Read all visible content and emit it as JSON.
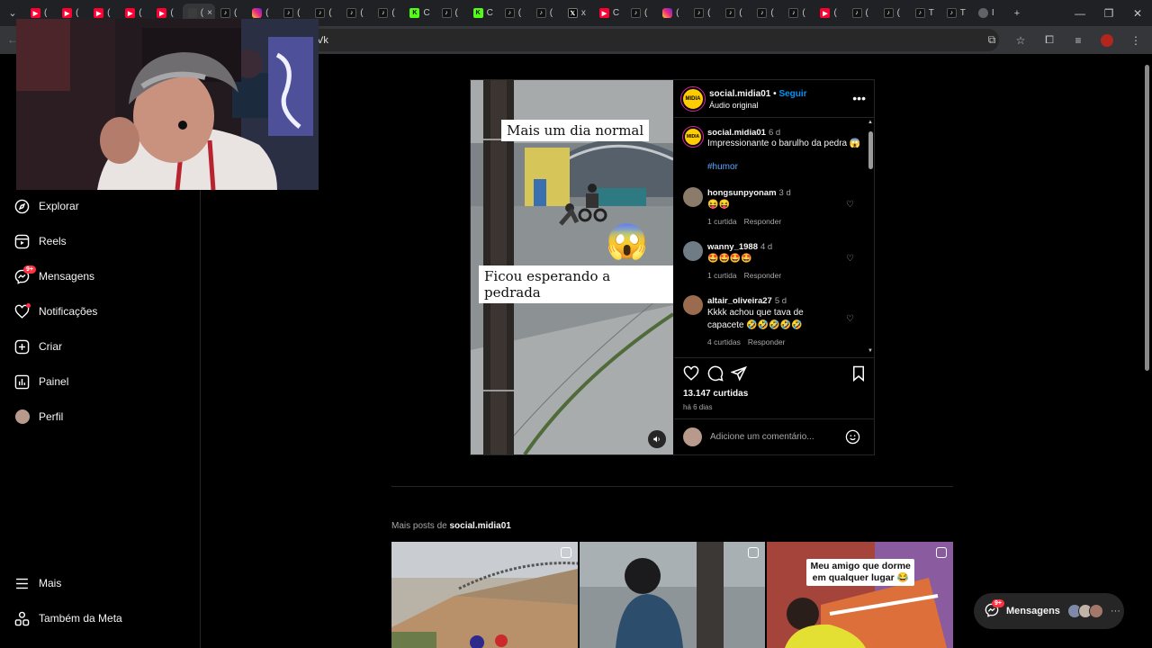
{
  "browser": {
    "tabs": [
      {
        "icon": "youtube",
        "label": "("
      },
      {
        "icon": "youtube",
        "label": "("
      },
      {
        "icon": "youtube",
        "label": "("
      },
      {
        "icon": "youtube",
        "label": "("
      },
      {
        "icon": "youtube",
        "label": "("
      },
      {
        "icon": "blank",
        "label": "(",
        "active": true,
        "close": "×"
      },
      {
        "icon": "tiktok",
        "label": "("
      },
      {
        "icon": "instagram",
        "label": "("
      },
      {
        "icon": "tiktok",
        "label": "("
      },
      {
        "icon": "tiktok",
        "label": "("
      },
      {
        "icon": "tiktok",
        "label": "("
      },
      {
        "icon": "tiktok",
        "label": "("
      },
      {
        "icon": "kick",
        "label": "C"
      },
      {
        "icon": "tiktok",
        "label": "("
      },
      {
        "icon": "kick",
        "label": "C"
      },
      {
        "icon": "tiktok",
        "label": "("
      },
      {
        "icon": "tiktok",
        "label": "("
      },
      {
        "icon": "x",
        "label": "x"
      },
      {
        "icon": "youtube",
        "label": "C"
      },
      {
        "icon": "tiktok",
        "label": "("
      },
      {
        "icon": "instagram",
        "label": "("
      },
      {
        "icon": "tiktok",
        "label": "("
      },
      {
        "icon": "tiktok",
        "label": "("
      },
      {
        "icon": "tiktok",
        "label": "("
      },
      {
        "icon": "tiktok",
        "label": "("
      },
      {
        "icon": "youtube",
        "label": "("
      },
      {
        "icon": "tiktok",
        "label": "("
      },
      {
        "icon": "tiktok",
        "label": "("
      },
      {
        "icon": "tiktok",
        "label": "T"
      },
      {
        "icon": "tiktok",
        "label": "T"
      },
      {
        "icon": "globe",
        "label": "I"
      }
    ],
    "new_tab": "+",
    "url_fragment": "Vk",
    "win": {
      "minimize": "—",
      "restore": "❐",
      "close": "✕"
    }
  },
  "sidebar": {
    "items": [
      {
        "name": "explore",
        "label": "Explorar"
      },
      {
        "name": "reels",
        "label": "Reels"
      },
      {
        "name": "messages",
        "label": "Mensagens",
        "badge": "9+"
      },
      {
        "name": "notifications",
        "label": "Notificações"
      },
      {
        "name": "create",
        "label": "Criar"
      },
      {
        "name": "dashboard",
        "label": "Painel"
      },
      {
        "name": "profile",
        "label": "Perfil"
      }
    ],
    "bottom": [
      {
        "name": "more",
        "label": "Mais"
      },
      {
        "name": "meta",
        "label": "Também da Meta"
      }
    ]
  },
  "post": {
    "username": "social.midia01",
    "avatar_text": "MIDIA",
    "follow": "Seguir",
    "separator": "•",
    "audio": "Áudio original",
    "video_caption_top": "Mais um dia normal",
    "video_caption_bottom": "Ficou esperando a pedrada",
    "video_emoji": "😱",
    "caption": {
      "user": "social.midia01",
      "time": "6 d",
      "text": "Impressionante o barulho da pedra 😱",
      "hashtag": "#humor"
    },
    "comments": [
      {
        "user": "hongsunpyonam",
        "time": "3 d",
        "text": "😝😝",
        "likes": "1 curtida",
        "reply": "Responder",
        "avatar_color": "#8a7b6a"
      },
      {
        "user": "wanny_1988",
        "time": "4 d",
        "text": "🤩🤩🤩🤩",
        "likes": "1 curtida",
        "reply": "Responder",
        "avatar_color": "#6f7c86"
      },
      {
        "user": "altair_oliveira27",
        "time": "5 d",
        "text": "Kkkk achou que tava de capacete 🤣🤣🤣🤣🤣",
        "likes": "4 curtidas",
        "reply": "Responder",
        "avatar_color": "#9a6b4e"
      }
    ],
    "likes": "13.147 curtidas",
    "ago": "há 6 dias",
    "add_comment_placeholder": "Adicione um comentário..."
  },
  "more_posts": {
    "prefix": "Mais posts de",
    "user": "social.midia01"
  },
  "grid": [
    {
      "caption": ""
    },
    {
      "caption": ""
    },
    {
      "caption": "Meu amigo que dorme em qualquer lugar 😂"
    }
  ],
  "messages_pill": {
    "label": "Mensagens",
    "badge": "9+",
    "more": "···"
  },
  "colors": {
    "accent": "#0095f6",
    "badge": "#ff3040",
    "bg": "#000000",
    "border": "#262626"
  }
}
